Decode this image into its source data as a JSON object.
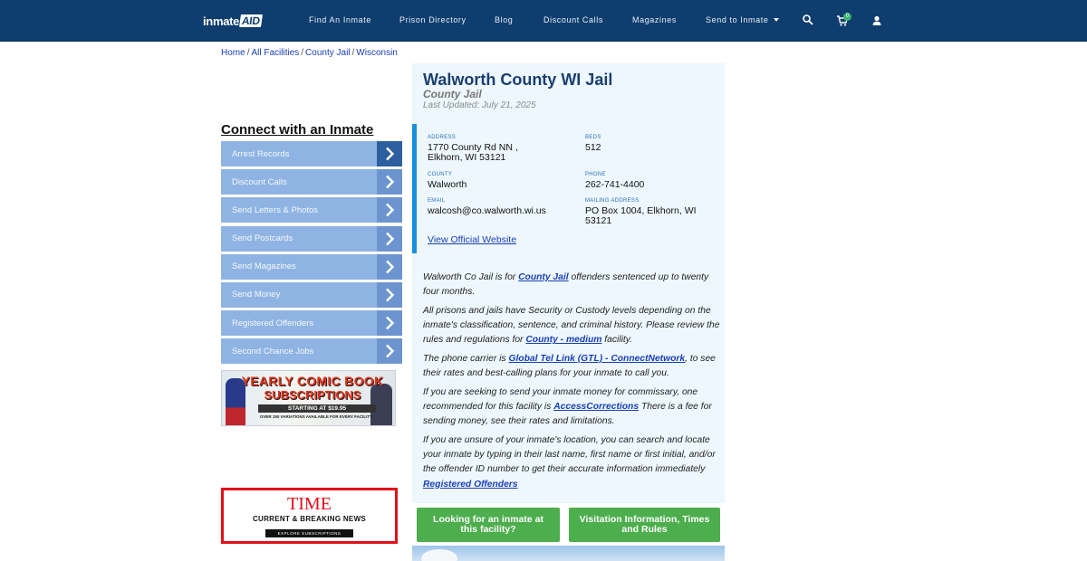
{
  "header": {
    "logo_main": "inmate",
    "logo_accent": "AID",
    "nav": [
      "Find An Inmate",
      "Prison Directory",
      "Blog",
      "Discount Calls",
      "Magazines",
      "Send to Inmate"
    ],
    "cart_count": "0",
    "colors": {
      "bar": "#0f3d6e",
      "badge": "#3cb371"
    }
  },
  "breadcrumb": [
    "Home",
    "All Facilities",
    "County Jail",
    "Wisconsin"
  ],
  "sidebar": {
    "title": "Connect with an Inmate",
    "items": [
      "Arrest Records",
      "Discount Calls",
      "Send Letters & Photos",
      "Send Postcards",
      "Send Magazines",
      "Send Money",
      "Registered Offenders",
      "Second Chance Jobs"
    ],
    "comic_ad": {
      "line1": "YEARLY COMIC BOOK",
      "line2": "SUBSCRIPTIONS",
      "line3": "STARTING AT $19.95",
      "line4": "OVER 150 VARIATIONS AVAILABLE FOR EVERY FACILITY"
    },
    "time_ad": {
      "brand": "TIME",
      "tagline": "CURRENT & BREAKING NEWS",
      "button": "EXPLORE SUBSCRIPTIONS"
    }
  },
  "facility": {
    "name": "Walworth County WI Jail",
    "type": "County Jail",
    "updated": "Last Updated: July 21, 2025",
    "address_label": "ADDRESS",
    "address_line1": "1770 County Rd NN ,",
    "address_line2": "Elkhorn, WI 53121",
    "beds_label": "BEDS",
    "beds": "512",
    "county_label": "COUNTY",
    "county": "Walworth",
    "phone_label": "PHONE",
    "phone": "262-741-4400",
    "email_label": "EMAIL",
    "email": "walcosh@co.walworth.wi.us",
    "mailing_label": "MAILING ADDRESS",
    "mailing_line1": "PO Box 1004, Elkhorn, WI",
    "mailing_line2": "53121",
    "website_link": "View Official Website"
  },
  "description": {
    "p1_pre": "Walworth Co Jail is for ",
    "p1_link": "County Jail",
    "p1_post": " offenders sentenced up to twenty four months.",
    "p2_pre": "All prisons and jails have Security or Custody levels depending on the inmate's classification, sentence, and criminal history. Please review the rules and regulations for ",
    "p2_link": "County - medium",
    "p2_post": " facility.",
    "p3_pre": "The phone carrier is ",
    "p3_link": "Global Tel Link (GTL) - ConnectNetwork",
    "p3_post": ", to see their rates and best-calling plans for your inmate to call you.",
    "p4_pre": "If you are seeking to send your inmate money for commissary, one recommended for this facility is ",
    "p4_link": "AccessCorrections",
    "p4_post": " There is a fee for sending money, see their rates and limitations.",
    "p5_pre": "If you are unsure of your inmate's location, you can search and locate your inmate by typing in their last name, first name or first initial, and/or the offender ID number to get their accurate information immediately",
    "p5_link": "Registered Offenders"
  },
  "cta": {
    "left": "Looking for an inmate at this facility?",
    "right": "Visitation Information, Times and Rules"
  }
}
